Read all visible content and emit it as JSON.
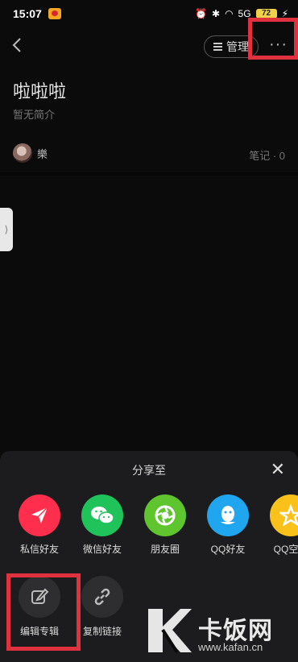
{
  "status_bar": {
    "time": "15:07",
    "network": "5G",
    "battery": "72"
  },
  "header": {
    "back_icon": "chevron-left-icon",
    "manage_label": "管理",
    "more_label": "···"
  },
  "album": {
    "title": "啦啦啦",
    "description": "暂无简介",
    "author": "樂",
    "notes_label": "笔记 · 0"
  },
  "side_handle": "⟩",
  "share_sheet": {
    "title": "分享至",
    "close_label": "✕",
    "share_targets": [
      {
        "label": "私信好友",
        "icon": "send-icon",
        "color": "#ff2e4d"
      },
      {
        "label": "微信好友",
        "icon": "wechat-icon",
        "color": "#1fc35a"
      },
      {
        "label": "朋友圈",
        "icon": "moments-icon",
        "color": "#5fc52e"
      },
      {
        "label": "QQ好友",
        "icon": "qq-icon",
        "color": "#1fa6ee"
      },
      {
        "label": "QQ空间",
        "icon": "qzone-icon",
        "color": "#fac11a"
      }
    ],
    "actions": [
      {
        "label": "编辑专辑",
        "icon": "edit-icon"
      },
      {
        "label": "复制链接",
        "icon": "link-icon"
      }
    ]
  },
  "watermark": {
    "text": "卡饭网",
    "url": "www.kafan.cn"
  }
}
